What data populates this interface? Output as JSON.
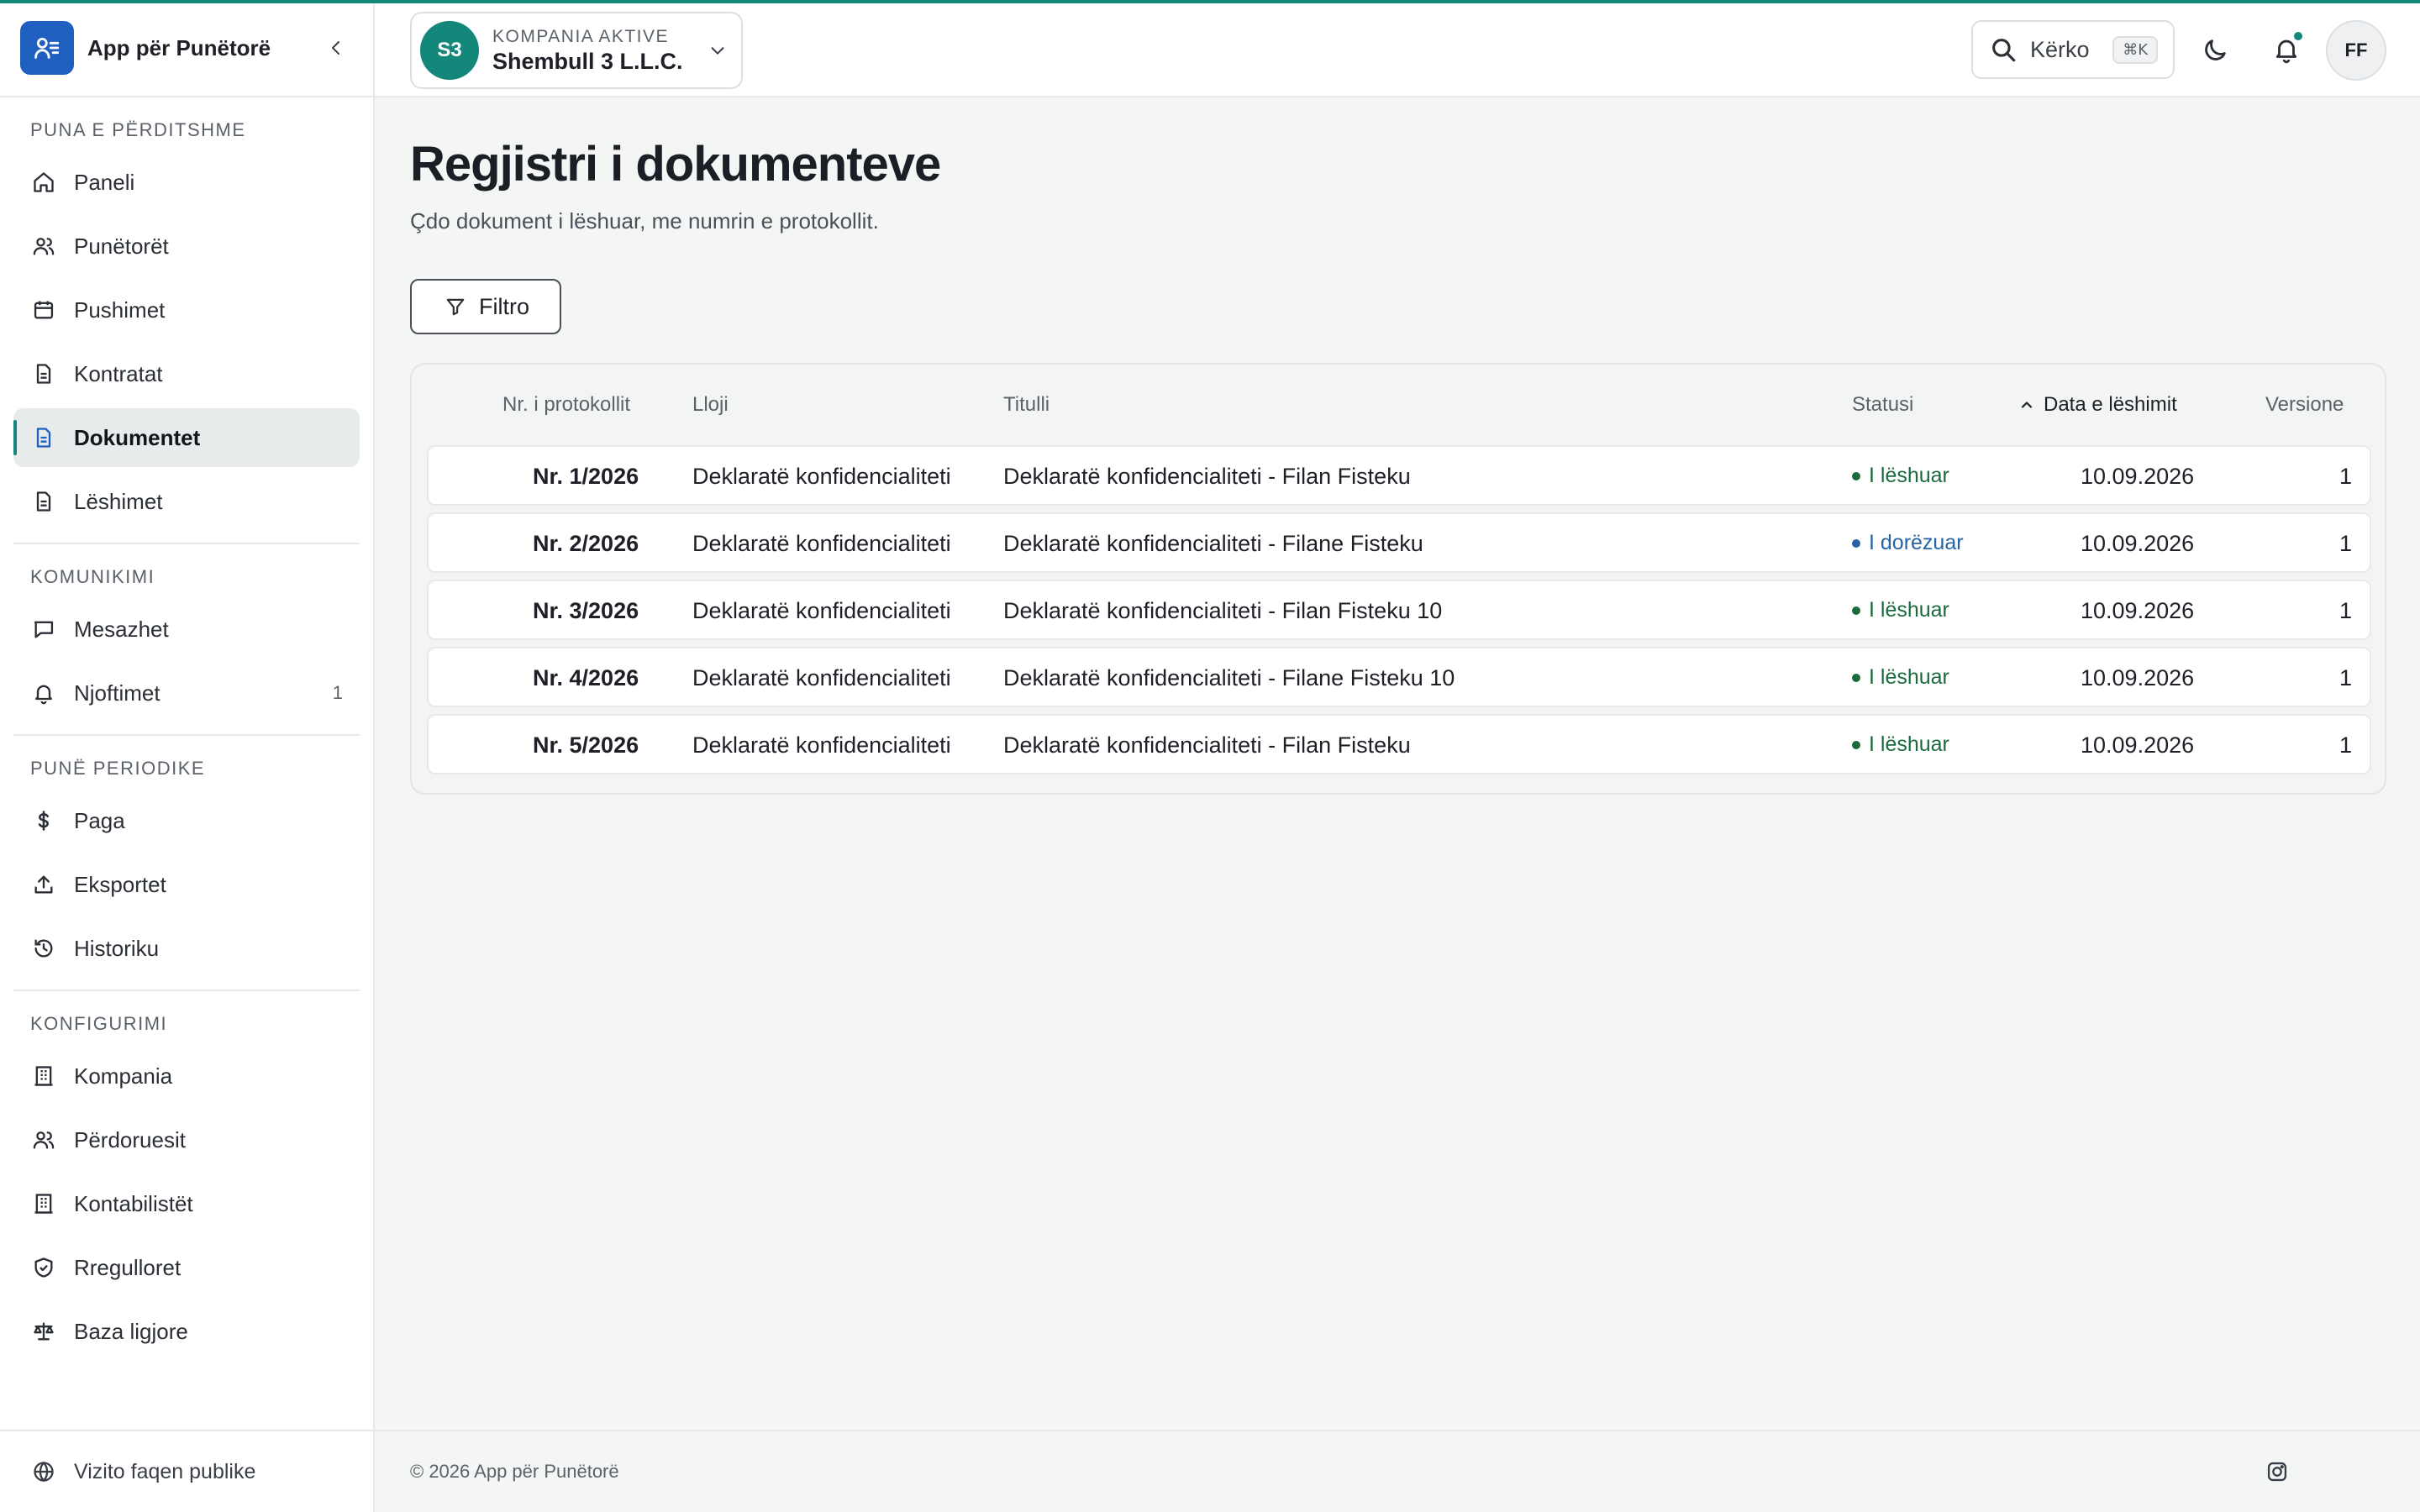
{
  "app": {
    "name": "App për Punëtorë"
  },
  "sidebar": {
    "sections": [
      {
        "title": "PUNA E PËRDITSHME"
      },
      {
        "title": "KOMUNIKIMI"
      },
      {
        "title": "PUNË PERIODIKE"
      },
      {
        "title": "KONFIGURIMI"
      }
    ],
    "items": [
      {
        "label": "Paneli",
        "icon": "home-icon"
      },
      {
        "label": "Punëtorët",
        "icon": "users-icon"
      },
      {
        "label": "Pushimet",
        "icon": "calendar-icon"
      },
      {
        "label": "Kontratat",
        "icon": "file-icon"
      },
      {
        "label": "Dokumentet",
        "icon": "file-icon",
        "active": true
      },
      {
        "label": "Lëshimet",
        "icon": "file-icon"
      },
      {
        "label": "Mesazhet",
        "icon": "message-icon"
      },
      {
        "label": "Njoftimet",
        "icon": "bell-icon",
        "count": "1"
      },
      {
        "label": "Paga",
        "icon": "dollar-icon"
      },
      {
        "label": "Eksportet",
        "icon": "upload-icon"
      },
      {
        "label": "Historiku",
        "icon": "history-icon"
      },
      {
        "label": "Kompania",
        "icon": "building-icon"
      },
      {
        "label": "Përdoruesit",
        "icon": "users-icon"
      },
      {
        "label": "Kontabilistët",
        "icon": "building-icon"
      },
      {
        "label": "Rregulloret",
        "icon": "shield-icon"
      },
      {
        "label": "Baza ligjore",
        "icon": "scale-icon"
      }
    ],
    "footer_link": "Vizito faqen publike"
  },
  "topbar": {
    "company_label": "KOMPANIA AKTIVE",
    "company_name": "Shembull 3 L.L.C.",
    "company_initials": "S3",
    "search_label": "Kërko",
    "search_shortcut": "⌘K",
    "user_initials": "FF"
  },
  "page": {
    "title": "Regjistri i dokumenteve",
    "subtitle": "Çdo dokument i lëshuar, me numrin e protokollit.",
    "filter_label": "Filtro"
  },
  "table": {
    "columns": [
      "Nr. i protokollit",
      "Lloji",
      "Titulli",
      "Statusi",
      "Data e lëshimit",
      "Versione"
    ],
    "sorted_column": "Data e lëshimit",
    "rows": [
      {
        "nr": "Nr. 1/2026",
        "type": "Deklaratë konfidencialiteti",
        "title": "Deklaratë konfidencialiteti - Filan Fisteku",
        "status": "I lëshuar",
        "date": "10.09.2026",
        "versions": "1"
      },
      {
        "nr": "Nr. 2/2026",
        "type": "Deklaratë konfidencialiteti",
        "title": "Deklaratë konfidencialiteti - Filane Fisteku",
        "status": "I dorëzuar",
        "date": "10.09.2026",
        "versions": "1"
      },
      {
        "nr": "Nr. 3/2026",
        "type": "Deklaratë konfidencialiteti",
        "title": "Deklaratë konfidencialiteti - Filan Fisteku 10",
        "status": "I lëshuar",
        "date": "10.09.2026",
        "versions": "1"
      },
      {
        "nr": "Nr. 4/2026",
        "type": "Deklaratë konfidencialiteti",
        "title": "Deklaratë konfidencialiteti - Filane Fisteku 10",
        "status": "I lëshuar",
        "date": "10.09.2026",
        "versions": "1"
      },
      {
        "nr": "Nr. 5/2026",
        "type": "Deklaratë konfidencialiteti",
        "title": "Deklaratë konfidencialiteti - Filan Fisteku",
        "status": "I lëshuar",
        "date": "10.09.2026",
        "versions": "1"
      }
    ]
  },
  "footer": {
    "copyright": "© 2026 App për Punëtorë"
  },
  "colors": {
    "accent": "#13877a",
    "brand": "#1f5fbf",
    "status_issued": "#1a6b3c",
    "status_submitted": "#2563a6"
  }
}
